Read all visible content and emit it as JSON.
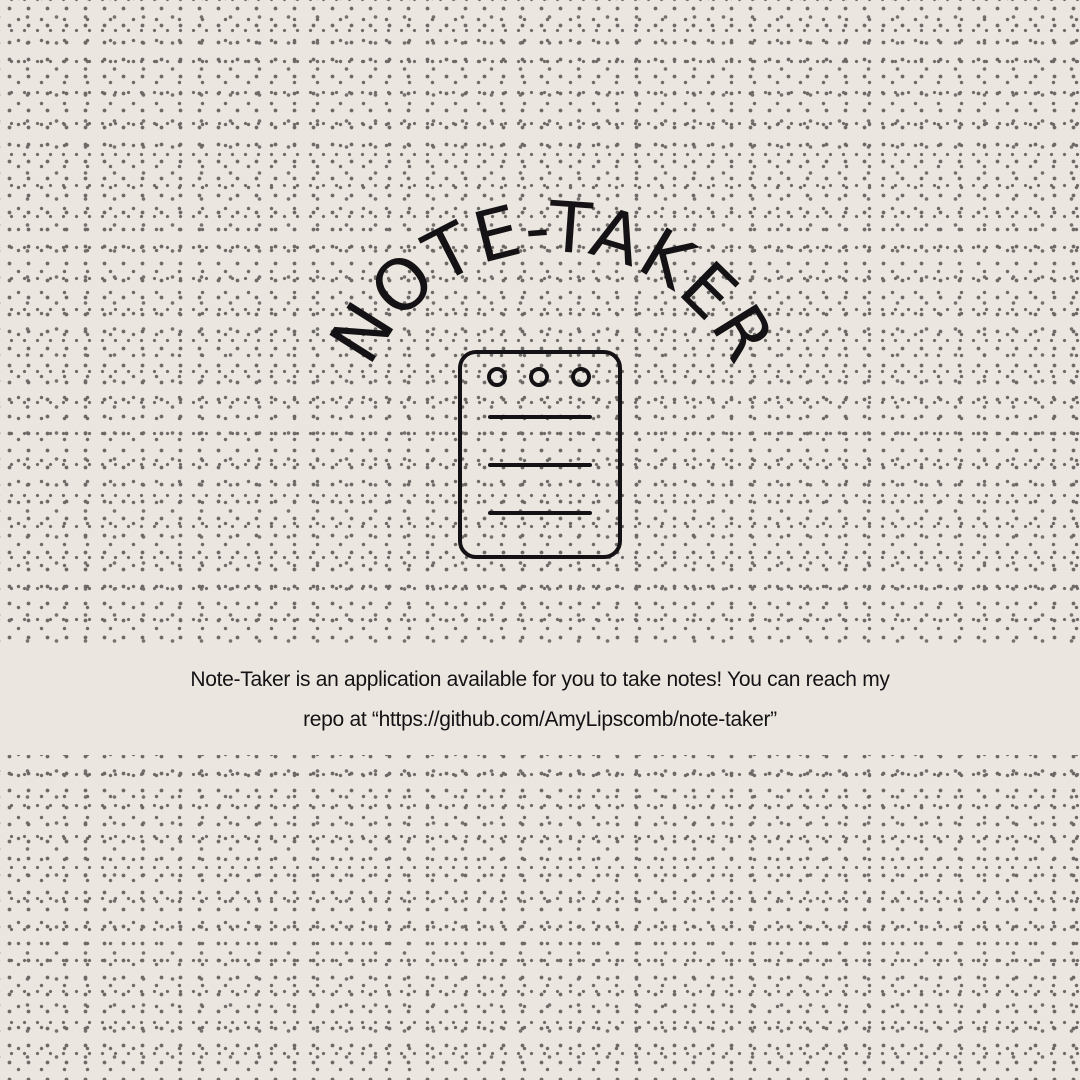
{
  "logo": {
    "title": "NOTE-TAKER",
    "icon": "notepad-icon"
  },
  "description": {
    "text": "Note-Taker is an application available for you to take notes! You can reach my repo at “https://github.com/AmyLipscomb/note-taker”"
  },
  "colors": {
    "background": "#ebe6e0",
    "ink": "#141214",
    "dots": "#6b6865"
  }
}
